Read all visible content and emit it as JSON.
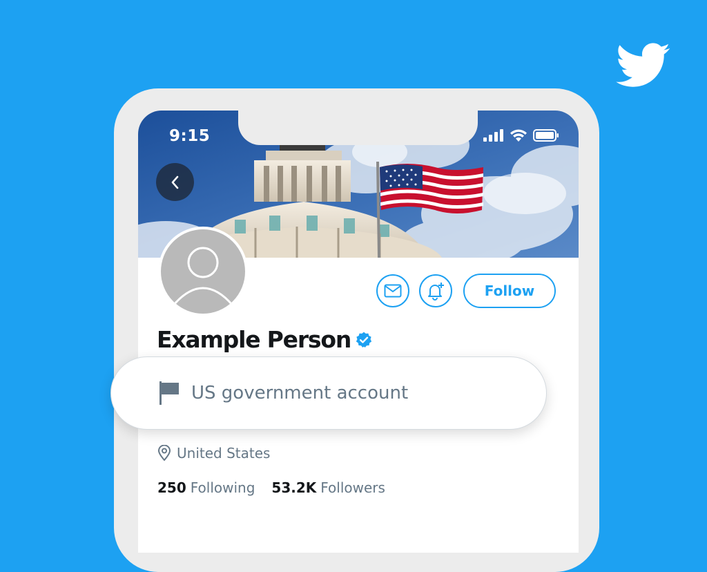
{
  "status_bar": {
    "time": "9:15"
  },
  "profile": {
    "name": "Example Person",
    "label": "US government account",
    "location": "United States",
    "following_count": "250",
    "following_label": "Following",
    "followers_count": "53.2K",
    "followers_label": "Followers"
  },
  "actions": {
    "follow_label": "Follow"
  },
  "colors": {
    "brand": "#1da1f2",
    "verified": "#1da1f2",
    "muted": "#657786"
  },
  "icons": [
    "twitter-bird-icon",
    "back-chevron-icon",
    "signal-icon",
    "wifi-icon",
    "battery-icon",
    "mail-icon",
    "bell-plus-icon",
    "verified-badge-icon",
    "flag-icon",
    "location-pin-icon"
  ]
}
